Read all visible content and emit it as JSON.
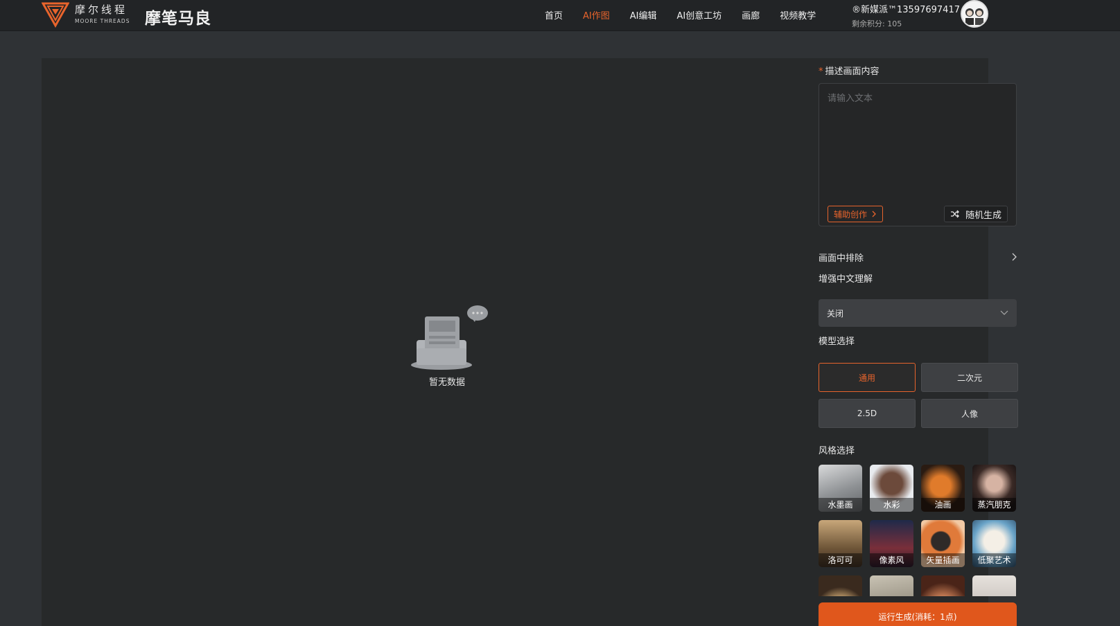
{
  "header": {
    "logo_cn": "摩尔线程",
    "logo_en": "MOORE THREADS",
    "app_title": "摩笔马良",
    "nav": [
      {
        "label": "首页",
        "active": false
      },
      {
        "label": "AI作图",
        "active": true
      },
      {
        "label": "AI编辑",
        "active": false
      },
      {
        "label": "AI创意工坊",
        "active": false
      },
      {
        "label": "画廊",
        "active": false
      },
      {
        "label": "视频教学",
        "active": false
      }
    ],
    "user_name": "®新媒派™13597697417",
    "user_points": "剩余积分: 105"
  },
  "canvas": {
    "empty_text": "暂无数据"
  },
  "panel": {
    "prompt_label": "描述画面内容",
    "prompt_required_mark": "*",
    "prompt_placeholder": "请输入文本",
    "prompt_value": "",
    "assist_label": "辅助创作",
    "random_label": "随机生成",
    "exclude_label": "画面中排除",
    "enhance_label": "增强中文理解",
    "enhance_value": "关闭",
    "model_label": "模型选择",
    "models": [
      "通用",
      "二次元",
      "2.5D",
      "人像"
    ],
    "model_selected": "通用",
    "style_label": "风格选择",
    "styles": [
      "水墨画",
      "水彩",
      "油画",
      "蒸汽朋克",
      "洛可可",
      "像素风",
      "矢量插画",
      "低聚艺术",
      "",
      "",
      "",
      ""
    ],
    "run_label": "运行生成(消耗：1点)"
  },
  "colors": {
    "accent": "#e8642c",
    "run_button": "#e0571c",
    "background": "#2f3235",
    "panel": "#27292a"
  }
}
